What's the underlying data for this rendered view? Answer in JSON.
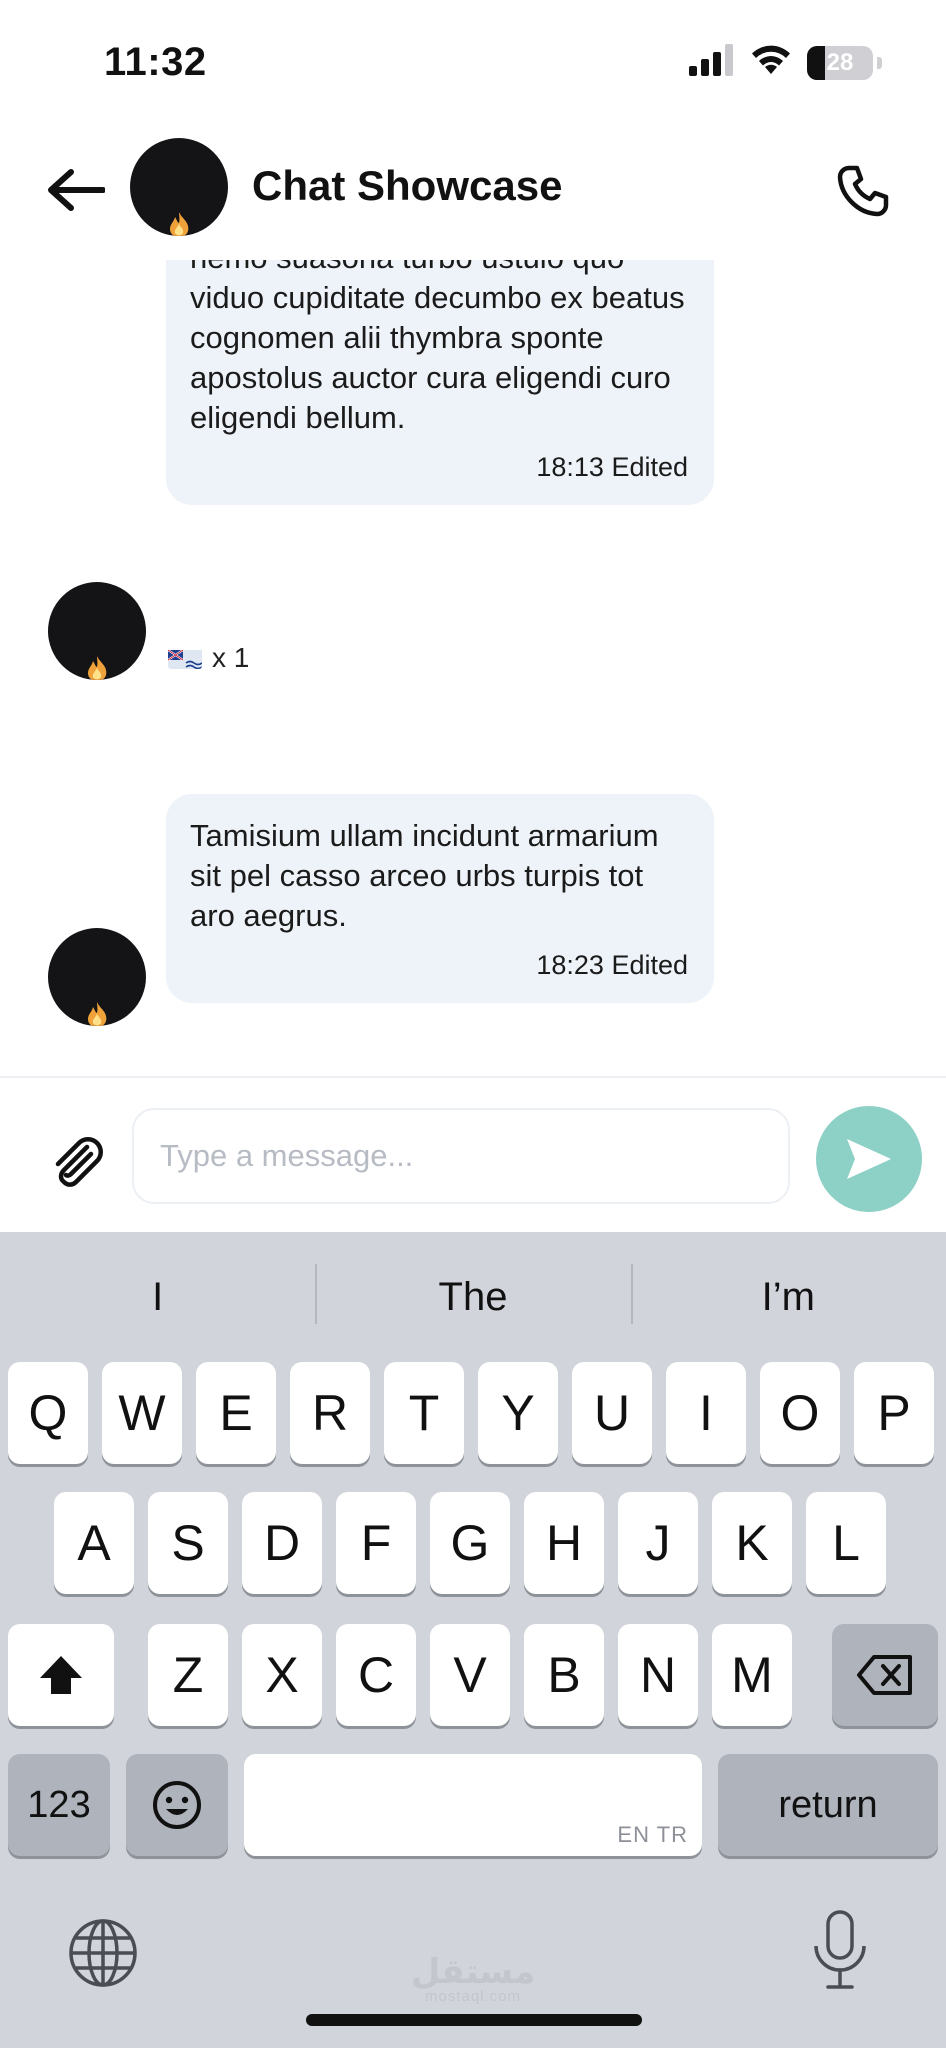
{
  "status_bar": {
    "time": "11:32",
    "battery": "28",
    "battery_level": 0.28
  },
  "header": {
    "title": "Chat Showcase"
  },
  "messages": [
    {
      "text": "deinde defaeco amita tristis laborum advoco cubicularis caput spargo nemo suasoria turbo ustulo quo viduo cupiditate decumbo ex beatus cognomen alii thymbra sponte apostolus auctor cura eligendi curo eligendi bellum.",
      "time_label": "18:13 Edited",
      "reaction": {
        "emoji": "flag-icon",
        "count_label": "x 1"
      }
    },
    {
      "text": "Tamisium ullam incidunt armarium sit pel casso arceo urbs turpis tot aro aegrus.",
      "time_label": "18:23 Edited"
    }
  ],
  "composer": {
    "placeholder": "Type a message...",
    "value": ""
  },
  "keyboard": {
    "suggestions": [
      "I",
      "The",
      "I’m"
    ],
    "rows": [
      [
        "Q",
        "W",
        "E",
        "R",
        "T",
        "Y",
        "U",
        "I",
        "O",
        "P"
      ],
      [
        "A",
        "S",
        "D",
        "F",
        "G",
        "H",
        "J",
        "K",
        "L"
      ],
      [
        "Z",
        "X",
        "C",
        "V",
        "B",
        "N",
        "M"
      ]
    ],
    "numbers_label": "123",
    "return_label": "return",
    "space_lang": "EN TR"
  },
  "colors": {
    "accent": "#8dd1c6",
    "bubble": "#eef3f9",
    "keyboard_bg": "#d1d4db"
  },
  "watermark": {
    "logo": "مستقل",
    "sub": "mostaql.com"
  }
}
